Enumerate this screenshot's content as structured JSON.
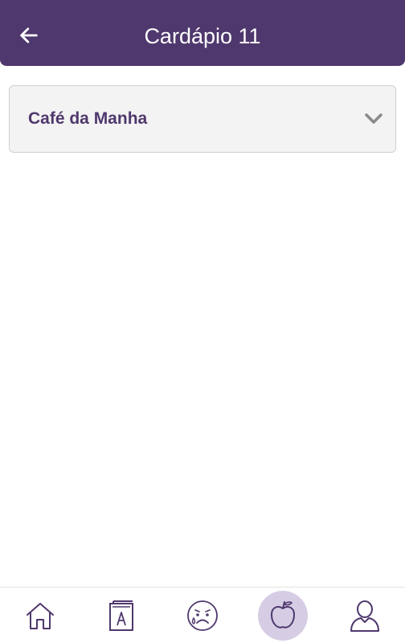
{
  "header": {
    "title": "Cardápio 11",
    "back_icon": "arrow-left-icon",
    "background": "#4f386d",
    "text_color": "#ffffff"
  },
  "sections": [
    {
      "label": "Café da Manha",
      "expanded": false,
      "icon": "chevron-down-icon"
    }
  ],
  "bottom_nav": {
    "items": [
      {
        "name": "home",
        "icon": "home-icon",
        "active": false
      },
      {
        "name": "book",
        "icon": "book-icon",
        "active": false
      },
      {
        "name": "mood",
        "icon": "sad-face-icon",
        "active": false
      },
      {
        "name": "diet",
        "icon": "apple-icon",
        "active": true
      },
      {
        "name": "profile",
        "icon": "user-icon",
        "active": false
      }
    ],
    "accent_color": "#4f386d",
    "active_background": "#d6cde5"
  }
}
